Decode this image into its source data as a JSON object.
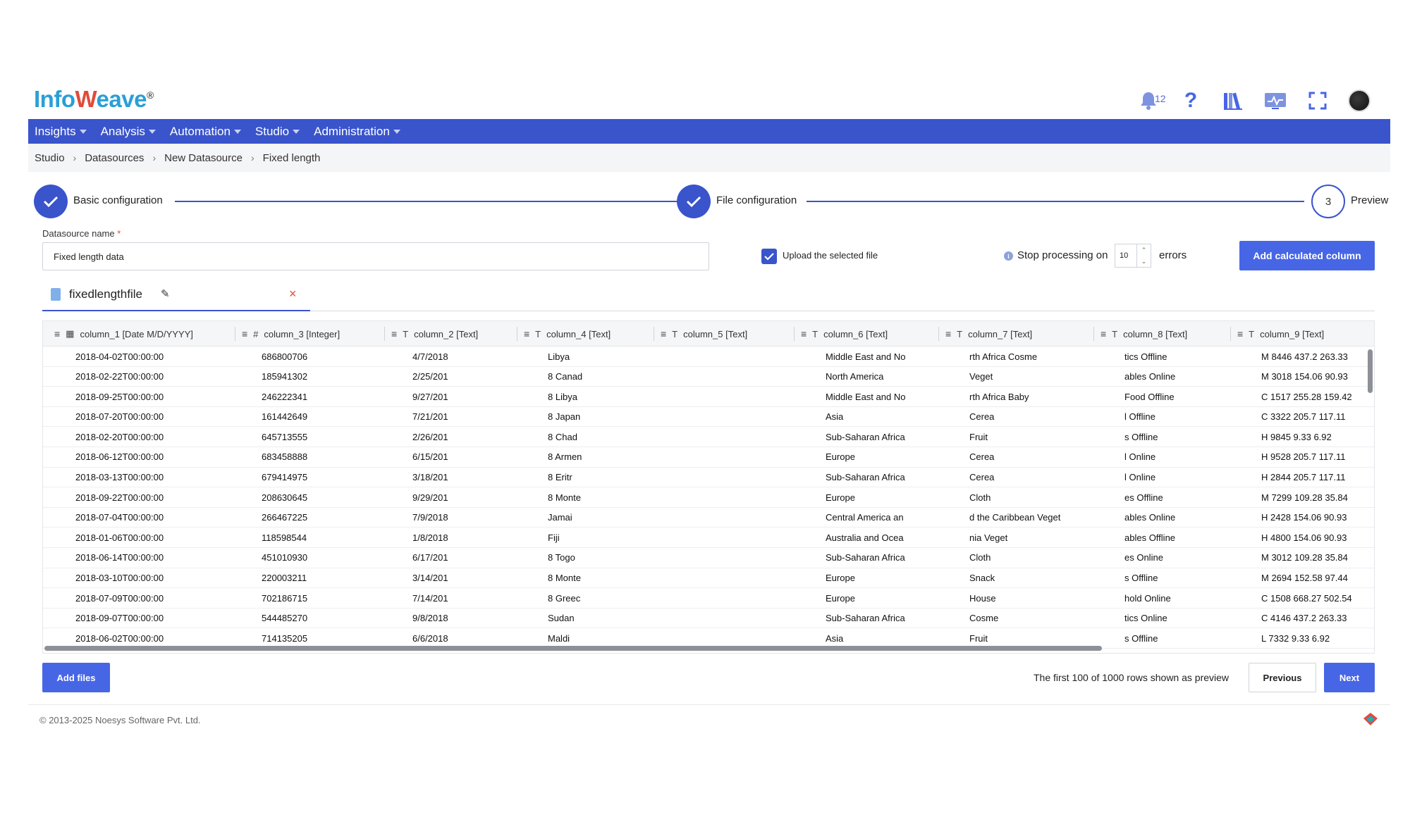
{
  "app": {
    "logo_text_a": "Info",
    "logo_text_w": "W",
    "logo_text_b": "eave",
    "logo_tm": "®"
  },
  "header": {
    "notifications_count": "12",
    "icons": [
      "bell-icon",
      "help-icon",
      "library-icon",
      "monitor-icon",
      "fullscreen-icon",
      "avatar"
    ]
  },
  "nav": {
    "items": [
      {
        "label": "Insights"
      },
      {
        "label": "Analysis"
      },
      {
        "label": "Automation"
      },
      {
        "label": "Studio"
      },
      {
        "label": "Administration"
      }
    ]
  },
  "breadcrumb": [
    "Studio",
    "Datasources",
    "New Datasource",
    "Fixed length"
  ],
  "stepper": {
    "steps": [
      {
        "label": "Basic configuration",
        "state": "done"
      },
      {
        "label": "File configuration",
        "state": "done"
      },
      {
        "label": "Preview",
        "state": "current",
        "number": "3"
      }
    ]
  },
  "form": {
    "datasource_label": "Datasource name",
    "required_mark": "*",
    "datasource_value": "Fixed length data",
    "upload_label": "Upload the selected file",
    "upload_checked": true,
    "stop_label": "Stop processing on",
    "stop_value": "10",
    "errors_label": "errors",
    "add_calc_label": "Add calculated column"
  },
  "file_tab": {
    "name": "fixedlengthfile"
  },
  "table": {
    "columns": [
      {
        "icon": "calendar-icon",
        "label": "column_1 [Date M/D/YYYY]"
      },
      {
        "icon": "hash-icon",
        "label": "column_3 [Integer]"
      },
      {
        "icon": "text-icon",
        "label": "column_2 [Text]"
      },
      {
        "icon": "text-icon",
        "label": "column_4 [Text]"
      },
      {
        "icon": "text-icon",
        "label": "column_5 [Text]"
      },
      {
        "icon": "text-icon",
        "label": "column_6 [Text]"
      },
      {
        "icon": "text-icon",
        "label": "column_7 [Text]"
      },
      {
        "icon": "text-icon",
        "label": "column_8 [Text]"
      },
      {
        "icon": "text-icon",
        "label": "column_9 [Text]"
      }
    ],
    "rows": [
      [
        "2018-04-02T00:00:00",
        "686800706",
        "4/7/2018",
        "Libya",
        "",
        "Middle East and No",
        "rth Africa Cosme",
        "tics Offline",
        "M 8446 437.2 263.33"
      ],
      [
        "2018-02-22T00:00:00",
        "185941302",
        "2/25/201",
        "8 Canad",
        "",
        "North America",
        "Veget",
        "ables Online",
        "M 3018 154.06 90.93"
      ],
      [
        "2018-09-25T00:00:00",
        "246222341",
        "9/27/201",
        "8 Libya",
        "",
        "Middle East and No",
        "rth Africa Baby",
        "Food Offline",
        "C 1517 255.28 159.42"
      ],
      [
        "2018-07-20T00:00:00",
        "161442649",
        "7/21/201",
        "8 Japan",
        "",
        "Asia",
        "Cerea",
        "l Offline",
        "C 3322 205.7 117.11"
      ],
      [
        "2018-02-20T00:00:00",
        "645713555",
        "2/26/201",
        "8 Chad",
        "",
        "Sub-Saharan Africa",
        "Fruit",
        "s Offline",
        "H 9845 9.33 6.92"
      ],
      [
        "2018-06-12T00:00:00",
        "683458888",
        "6/15/201",
        "8 Armen",
        "",
        "Europe",
        "Cerea",
        "l Online",
        "H 9528 205.7 117.11"
      ],
      [
        "2018-03-13T00:00:00",
        "679414975",
        "3/18/201",
        "8 Eritr",
        "",
        "Sub-Saharan Africa",
        "Cerea",
        "l Online",
        "H 2844 205.7 117.11"
      ],
      [
        "2018-09-22T00:00:00",
        "208630645",
        "9/29/201",
        "8 Monte",
        "",
        "Europe",
        "Cloth",
        "es Offline",
        "M 7299 109.28 35.84"
      ],
      [
        "2018-07-04T00:00:00",
        "266467225",
        "7/9/2018",
        "Jamai",
        "",
        "Central America an",
        "d the Caribbean Veget",
        "ables Online",
        "H 2428 154.06 90.93"
      ],
      [
        "2018-01-06T00:00:00",
        "118598544",
        "1/8/2018",
        "Fiji",
        "",
        "Australia and Ocea",
        "nia Veget",
        "ables Offline",
        "H 4800 154.06 90.93"
      ],
      [
        "2018-06-14T00:00:00",
        "451010930",
        "6/17/201",
        "8 Togo",
        "",
        "Sub-Saharan Africa",
        "Cloth",
        "es Online",
        "M 3012 109.28 35.84"
      ],
      [
        "2018-03-10T00:00:00",
        "220003211",
        "3/14/201",
        "8 Monte",
        "",
        "Europe",
        "Snack",
        "s Offline",
        "M 2694 152.58 97.44"
      ],
      [
        "2018-07-09T00:00:00",
        "702186715",
        "7/14/201",
        "8 Greec",
        "",
        "Europe",
        "House",
        "hold Online",
        "C 1508 668.27 502.54"
      ],
      [
        "2018-09-07T00:00:00",
        "544485270",
        "9/8/2018",
        "Sudan",
        "",
        "Sub-Saharan Africa",
        "Cosme",
        "tics Online",
        "C 4146 437.2 263.33"
      ],
      [
        "2018-06-02T00:00:00",
        "714135205",
        "6/6/2018",
        "Maldi",
        "",
        "Asia",
        "Fruit",
        "s Offline",
        "L 7332 9.33 6.92"
      ]
    ]
  },
  "footer_actions": {
    "add_files_label": "Add files",
    "preview_text": "The first 100 of 1000 rows shown as preview",
    "previous_label": "Previous",
    "next_label": "Next"
  },
  "footer": {
    "copyright": "© 2013-2025 Noesys Software Pvt. Ltd."
  },
  "colors": {
    "primary": "#3a54cc",
    "button": "#4766e6",
    "danger": "#e04b3a"
  }
}
